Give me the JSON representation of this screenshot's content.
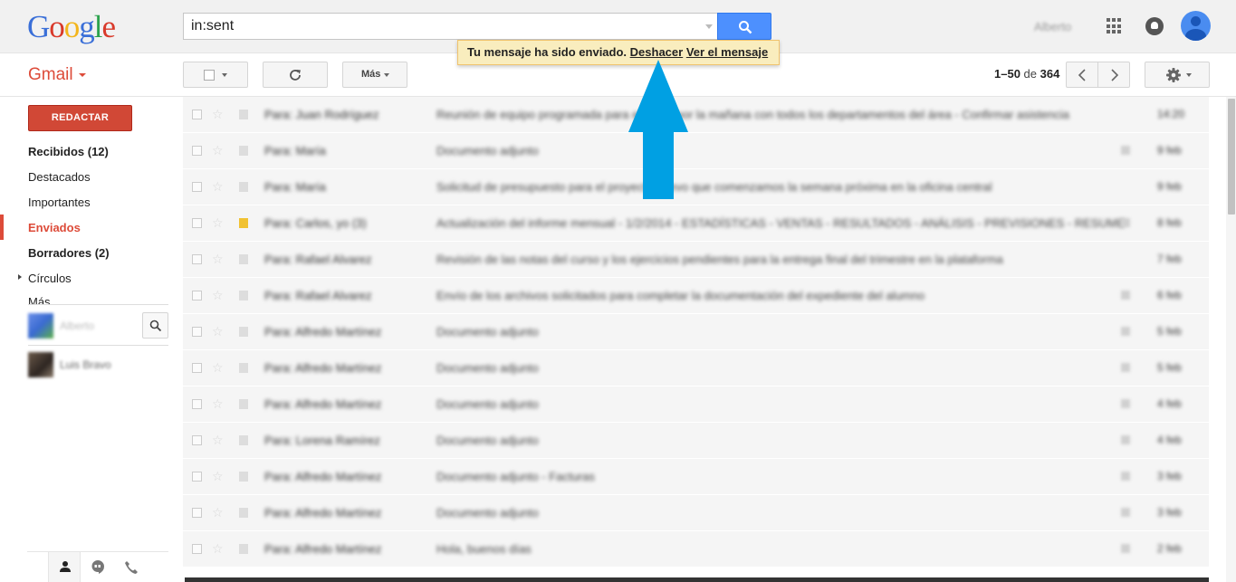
{
  "header": {
    "logo_text": "Google",
    "search_value": "in:sent",
    "search_icon": "magnifier-icon",
    "user_name": "Alberto",
    "apps_icon": "apps-grid-icon",
    "notifications_icon": "bell-icon",
    "avatar_icon": "account-avatar"
  },
  "toast": {
    "message": "Tu mensaje ha sido enviado.",
    "undo_link": "Deshacer",
    "view_link": "Ver el mensaje"
  },
  "toolbar": {
    "app_label": "Gmail",
    "more_label": "Más",
    "refresh_icon": "refresh-icon",
    "settings_icon": "gear-icon",
    "pager": {
      "range": "1–50",
      "of": "de",
      "total": "364"
    }
  },
  "sidebar": {
    "compose_label": "REDACTAR",
    "items": [
      {
        "label": "Recibidos (12)",
        "style": "bold"
      },
      {
        "label": "Destacados",
        "style": "normal"
      },
      {
        "label": "Importantes",
        "style": "normal"
      },
      {
        "label": "Enviados",
        "style": "active"
      },
      {
        "label": "Borradores (2)",
        "style": "bold"
      },
      {
        "label": "Círculos",
        "style": "normal"
      },
      {
        "label": "Más",
        "style": "normal"
      }
    ],
    "chat_contacts": [
      "Alberto",
      "Luis Bravo"
    ],
    "bottom_tabs": [
      "person-icon",
      "hangouts-icon",
      "phone-icon"
    ]
  },
  "emails": [
    {
      "sender": "Para: Juan Rodríguez",
      "subject": "Reunión de equipo programada para el lunes por la mañana con todos los departamentos del área - Confirmar asistencia",
      "date": "14:20",
      "important": false,
      "attach": false
    },
    {
      "sender": "Para: María",
      "subject": "Documento adjunto",
      "date": "9 feb",
      "important": false,
      "attach": true
    },
    {
      "sender": "Para: María",
      "subject": "Solicitud de presupuesto para el proyecto nuevo que comenzamos la semana próxima en la oficina central",
      "date": "9 feb",
      "important": false,
      "attach": false
    },
    {
      "sender": "Para: Carlos, yo (3)",
      "subject": "Actualización del informe mensual - 1/2/2014 - ESTADÍSTICAS - VENTAS - RESULTADOS - ANÁLISIS - PREVISIONES - RESUMEN",
      "date": "8 feb",
      "important": true,
      "attach": true
    },
    {
      "sender": "Para: Rafael Alvarez",
      "subject": "Revisión de las notas del curso y los ejercicios pendientes para la entrega final del trimestre en la plataforma",
      "date": "7 feb",
      "important": false,
      "attach": false
    },
    {
      "sender": "Para: Rafael Alvarez",
      "subject": "Envío de los archivos solicitados para completar la documentación del expediente del alumno",
      "date": "6 feb",
      "important": false,
      "attach": true
    },
    {
      "sender": "Para: Alfredo Martínez",
      "subject": "Documento adjunto",
      "date": "5 feb",
      "important": false,
      "attach": true
    },
    {
      "sender": "Para: Alfredo Martínez",
      "subject": "Documento adjunto",
      "date": "5 feb",
      "important": false,
      "attach": true
    },
    {
      "sender": "Para: Alfredo Martínez",
      "subject": "Documento adjunto",
      "date": "4 feb",
      "important": false,
      "attach": true
    },
    {
      "sender": "Para: Lorena Ramírez",
      "subject": "Documento adjunto",
      "date": "4 feb",
      "important": false,
      "attach": true
    },
    {
      "sender": "Para: Alfredo Martínez",
      "subject": "Documento adjunto - Facturas",
      "date": "3 feb",
      "important": false,
      "attach": true
    },
    {
      "sender": "Para: Alfredo Martínez",
      "subject": "Documento adjunto",
      "date": "3 feb",
      "important": false,
      "attach": true
    },
    {
      "sender": "Para: Alfredo Martínez",
      "subject": "Hola, buenos días",
      "date": "2 feb",
      "important": false,
      "attach": true
    }
  ],
  "colors": {
    "accent_red": "#dd4b39",
    "compose_red": "#d14836",
    "search_blue": "#4d90fe",
    "toast_bg": "#f9edbe",
    "arrow_blue": "#00a0e3"
  }
}
